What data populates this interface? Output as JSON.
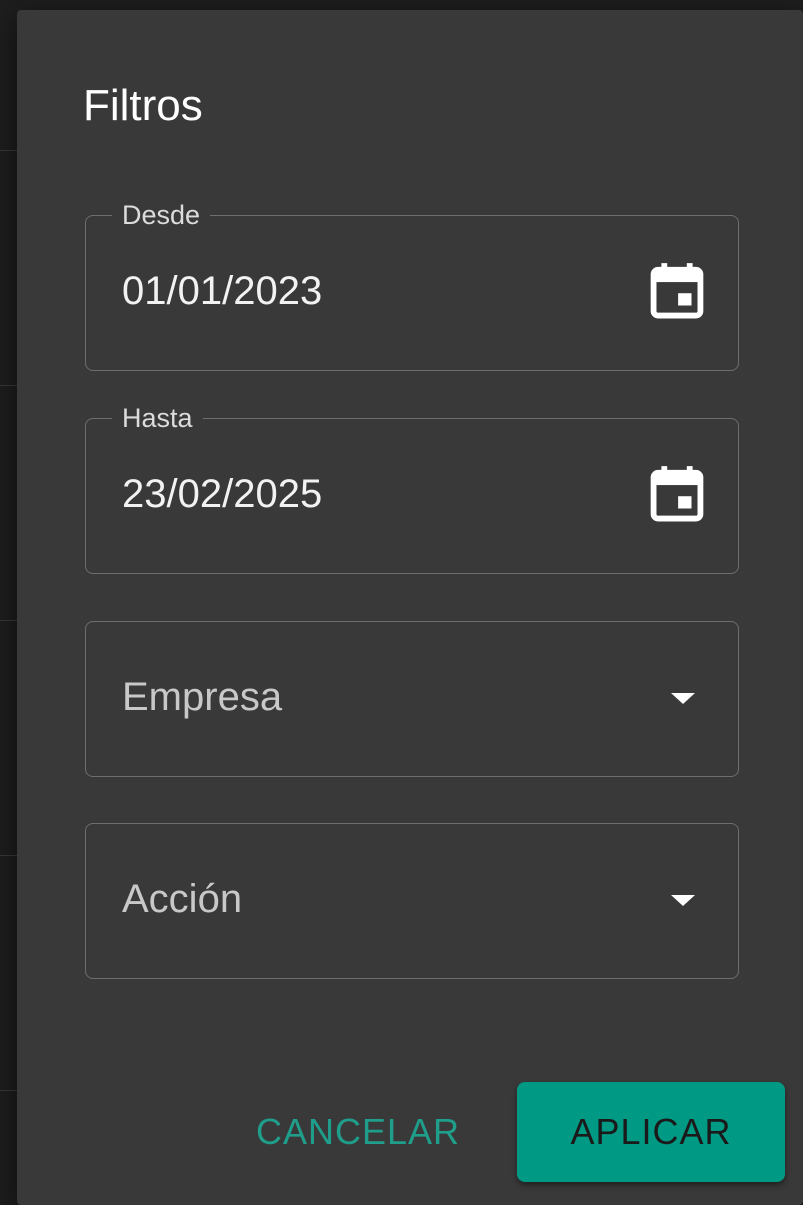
{
  "dialog": {
    "title": "Filtros"
  },
  "fields": {
    "desde": {
      "label": "Desde",
      "value": "01/01/2023",
      "icon": "calendar-icon"
    },
    "hasta": {
      "label": "Hasta",
      "value": "23/02/2025",
      "icon": "calendar-icon"
    },
    "empresa": {
      "placeholder": "Empresa",
      "icon": "chevron-down-icon"
    },
    "accion": {
      "placeholder": "Acción",
      "icon": "chevron-down-icon"
    }
  },
  "actions": {
    "cancel_label": "CANCELAR",
    "apply_label": "APLICAR"
  },
  "colors": {
    "dialog_bg": "#393939",
    "accent": "#009a84",
    "accent_text": "#1f9e8c"
  }
}
